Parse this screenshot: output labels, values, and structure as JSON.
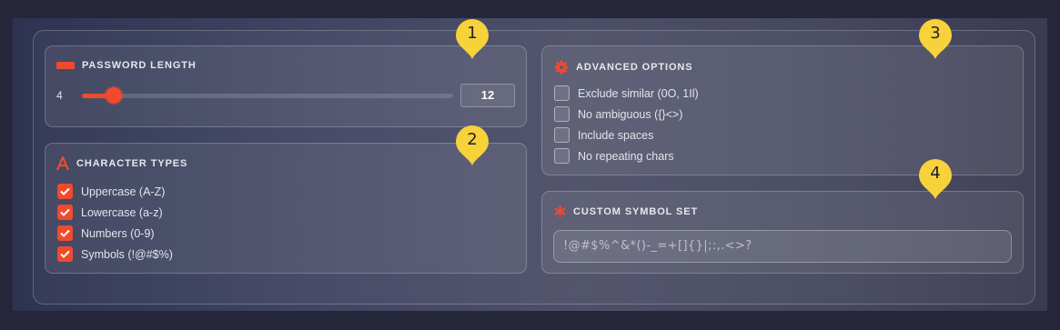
{
  "password_length": {
    "title": "PASSWORD LENGTH",
    "min_label": "4",
    "value": "12",
    "slider_fraction": 0.085
  },
  "character_types": {
    "title": "CHARACTER TYPES",
    "items": [
      {
        "label": "Uppercase (A-Z)",
        "checked": true
      },
      {
        "label": "Lowercase (a-z)",
        "checked": true
      },
      {
        "label": "Numbers (0-9)",
        "checked": true
      },
      {
        "label": "Symbols (!@#$%)",
        "checked": true
      }
    ]
  },
  "advanced_options": {
    "title": "ADVANCED OPTIONS",
    "items": [
      {
        "label": "Exclude similar (0O, 1Il)",
        "checked": false
      },
      {
        "label": "No ambiguous ({}<>)",
        "checked": false
      },
      {
        "label": "Include spaces",
        "checked": false
      },
      {
        "label": "No repeating chars",
        "checked": false
      }
    ]
  },
  "custom_symbols": {
    "title": "CUSTOM SYMBOL SET",
    "value": "!@#$%^&*()-_=+[]{}|;:,.<>?"
  },
  "callouts": [
    "1",
    "2",
    "3",
    "4"
  ],
  "colors": {
    "accent": "#f04a2e",
    "badge": "#f7d23a",
    "background": "#25263a"
  }
}
